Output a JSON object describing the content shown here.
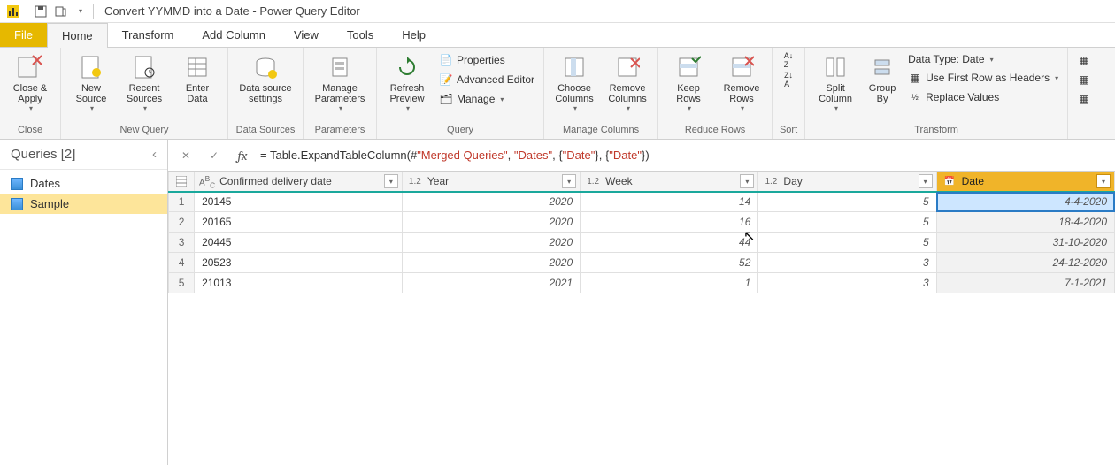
{
  "window": {
    "title": "Convert YYMMD into a Date - Power Query Editor"
  },
  "tabs": {
    "file": "File",
    "home": "Home",
    "transform": "Transform",
    "addcol": "Add Column",
    "view": "View",
    "tools": "Tools",
    "help": "Help"
  },
  "ribbon": {
    "close": {
      "label": "Close &\nApply",
      "group": "Close"
    },
    "newq": {
      "new": "New\nSource",
      "recent": "Recent\nSources",
      "enter": "Enter\nData",
      "group": "New Query"
    },
    "ds": {
      "settings": "Data source\nsettings",
      "group": "Data Sources"
    },
    "param": {
      "manage": "Manage\nParameters",
      "group": "Parameters"
    },
    "query": {
      "refresh": "Refresh\nPreview",
      "props": "Properties",
      "adv": "Advanced Editor",
      "manage": "Manage",
      "group": "Query"
    },
    "cols": {
      "choose": "Choose\nColumns",
      "remove": "Remove\nColumns",
      "group": "Manage Columns"
    },
    "rows": {
      "keep": "Keep\nRows",
      "remove": "Remove\nRows",
      "group": "Reduce Rows"
    },
    "sort": {
      "group": "Sort"
    },
    "trans": {
      "split": "Split\nColumn",
      "group_by": "Group\nBy",
      "datatype": "Data Type: Date",
      "firstrow": "Use First Row as Headers",
      "replace": "Replace Values",
      "group": "Transform"
    }
  },
  "queries": {
    "header": "Queries [2]",
    "items": [
      "Dates",
      "Sample"
    ],
    "selected": 1
  },
  "formula": {
    "prefix": "= Table.ExpandTableColumn(#",
    "s1": "\"Merged Queries\"",
    "m1": ", ",
    "s2": "\"Dates\"",
    "m2": ", {",
    "s3": "\"Date\"",
    "m3": "}, {",
    "s4": "\"Date\"",
    "m4": "})"
  },
  "columns": [
    {
      "name": "Confirmed delivery date",
      "type": "ABC",
      "kind": "text"
    },
    {
      "name": "Year",
      "type": "1.2",
      "kind": "num"
    },
    {
      "name": "Week",
      "type": "1.2",
      "kind": "num"
    },
    {
      "name": "Day",
      "type": "1.2",
      "kind": "num"
    },
    {
      "name": "Date",
      "type": "📅",
      "kind": "date"
    }
  ],
  "rows": [
    {
      "n": "1",
      "c": "20145",
      "y": "2020",
      "w": "14",
      "d": "5",
      "dt": "4-4-2020"
    },
    {
      "n": "2",
      "c": "20165",
      "y": "2020",
      "w": "16",
      "d": "5",
      "dt": "18-4-2020"
    },
    {
      "n": "3",
      "c": "20445",
      "y": "2020",
      "w": "44",
      "d": "5",
      "dt": "31-10-2020"
    },
    {
      "n": "4",
      "c": "20523",
      "y": "2020",
      "w": "52",
      "d": "3",
      "dt": "24-12-2020"
    },
    {
      "n": "5",
      "c": "21013",
      "y": "2021",
      "w": "1",
      "d": "3",
      "dt": "7-1-2021"
    }
  ]
}
